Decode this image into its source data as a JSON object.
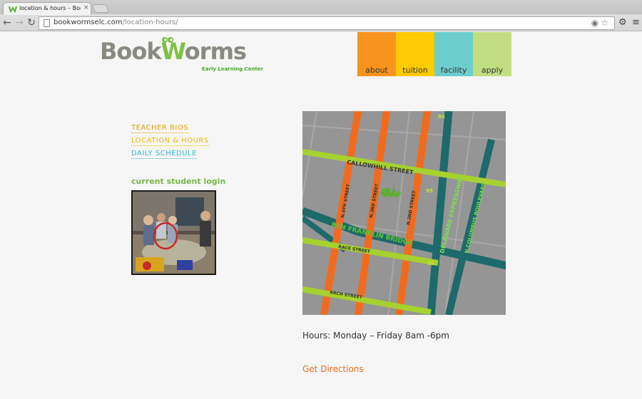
{
  "browser": {
    "tab_title": "location & hours – Book W",
    "tab_close": "×",
    "url_host": "bookwormselc.com",
    "url_path": "/location-hours/"
  },
  "logo": {
    "word1": "Book",
    "word2_first": "W",
    "word2_rest": "orms",
    "subtitle": "Early Learning Center"
  },
  "nav": {
    "about": "about",
    "tuition": "tuition",
    "facility": "facility",
    "apply": "apply"
  },
  "sidebar": {
    "links": [
      "TEACHER BIOS",
      "LOCATION & HOURS",
      "DAILY SCHEDULE"
    ],
    "login_title": "current student login"
  },
  "map": {
    "streets": {
      "callowhill": "CALLOWHILL STREET",
      "ben_franklin": "BEN FRANKLIN BRIDGE",
      "race": "RACE STREET",
      "arch": "ARCH STREET",
      "n4th": "N.4TH STREET",
      "n3rd": "N.3RD STREET",
      "n2nd": "N.2ND STREET",
      "delaware": "DELAWARE EXPRESSWAY",
      "columbus": "N.COLUMBUS BOULEVARD"
    },
    "route_number": "95"
  },
  "main": {
    "hours": "Hours: Monday – Friday 8am -6pm",
    "directions": "Get Directions"
  },
  "colors": {
    "orange": "#f7941d",
    "yellow": "#ffcb05",
    "teal": "#6dcdcd",
    "green": "#c1de82",
    "map_street": "#f26b1d",
    "map_cross": "#a6d12f",
    "map_highway": "#1e6a6a"
  }
}
